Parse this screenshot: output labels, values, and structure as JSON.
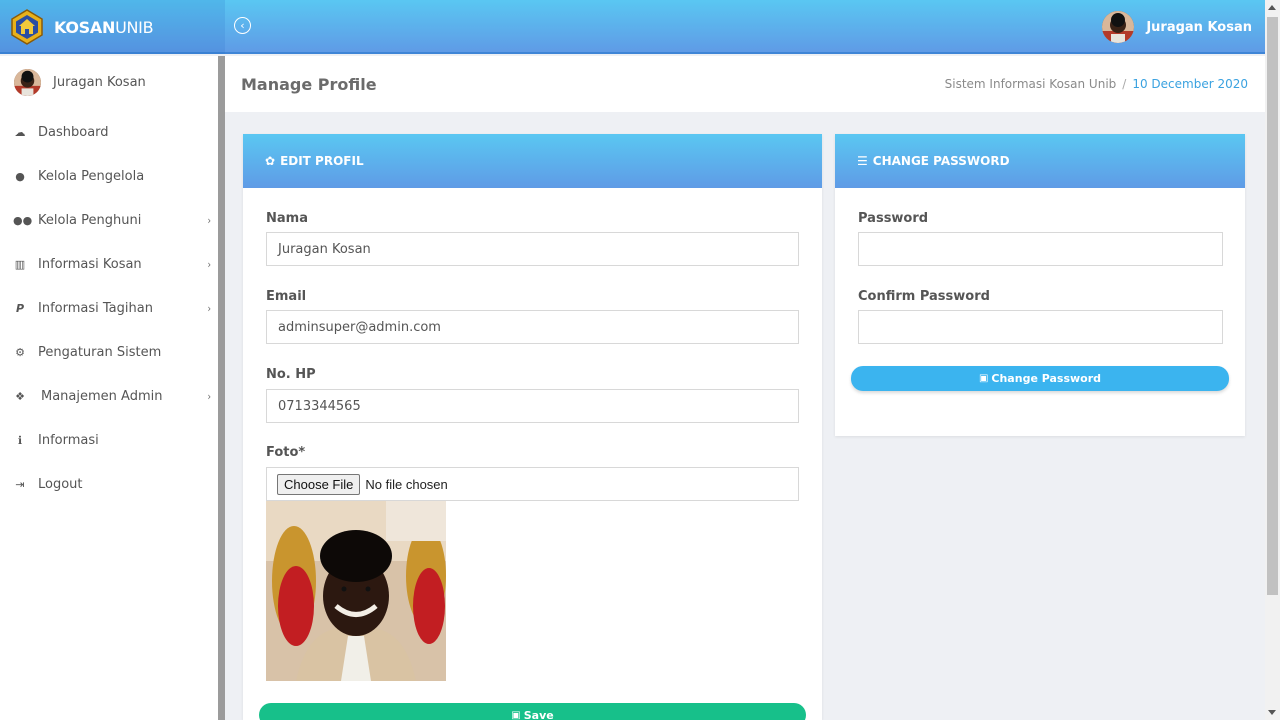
{
  "brand": {
    "bold": "KOSAN",
    "light": "UNIB"
  },
  "topbar": {
    "user_name": "Juragan Kosan",
    "toggle_icon": "arrow-left-circle-icon"
  },
  "sidebar": {
    "user_name": "Juragan Kosan",
    "items": [
      {
        "label": "Dashboard",
        "icon": "dashboard-icon",
        "has_children": false
      },
      {
        "label": "Kelola Pengelola",
        "icon": "user-icon",
        "has_children": false
      },
      {
        "label": "Kelola Penghuni",
        "icon": "users-icon",
        "has_children": true
      },
      {
        "label": "Informasi Kosan",
        "icon": "bank-icon",
        "has_children": true
      },
      {
        "label": "Informasi Tagihan",
        "icon": "paypal-icon",
        "has_children": true
      },
      {
        "label": "Pengaturan Sistem",
        "icon": "cogs-icon",
        "has_children": false
      },
      {
        "label": "Manajemen Admin",
        "icon": "cubes-icon",
        "has_children": true
      },
      {
        "label": "Informasi",
        "icon": "info-icon",
        "has_children": false
      },
      {
        "label": "Logout",
        "icon": "sign-out-icon",
        "has_children": false
      }
    ]
  },
  "header": {
    "title": "Manage Profile",
    "breadcrumb": {
      "root": "Sistem Informasi Kosan Unib",
      "separator": "/",
      "current": "10 December 2020"
    }
  },
  "edit_profile": {
    "heading": "EDIT PROFIL",
    "fields": {
      "nama": {
        "label": "Nama",
        "value": "Juragan Kosan"
      },
      "email": {
        "label": "Email",
        "value": "adminsuper@admin.com"
      },
      "hp": {
        "label": "No. HP",
        "value": "0713344565"
      },
      "foto": {
        "label": "Foto*",
        "button": "Choose File",
        "status": "No file chosen"
      }
    },
    "save_label": "Save"
  },
  "change_password": {
    "heading": "CHANGE PASSWORD",
    "password_label": "Password",
    "confirm_label": "Confirm Password",
    "button_label": "Change Password"
  },
  "colors": {
    "header_gradient_top": "#5ac7f2",
    "header_gradient_bottom": "#5f9be6",
    "save_button": "#17c08a",
    "password_button": "#3bb4ef",
    "breadcrumb_active": "#3aa2e0"
  }
}
